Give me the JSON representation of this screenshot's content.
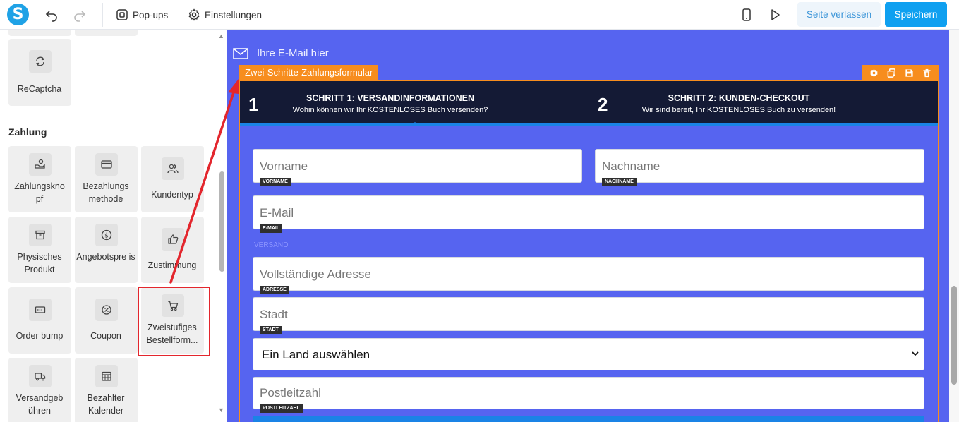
{
  "topbar": {
    "logo_letter": "S",
    "popups_label": "Pop-ups",
    "settings_label": "Einstellungen",
    "leave_label": "Seite verlassen",
    "save_label": "Speichern"
  },
  "sidebar": {
    "top_tile": {
      "label": "ReCaptcha",
      "icon": "refresh-icon"
    },
    "section_title": "Zahlung",
    "tiles": [
      {
        "label": "Zahlungskno pf",
        "icon": "hand-coin-icon"
      },
      {
        "label": "Bezahlungs methode",
        "icon": "credit-card-icon"
      },
      {
        "label": "Kundentyp",
        "icon": "users-icon"
      },
      {
        "label": "Physisches Produkt",
        "icon": "box-icon"
      },
      {
        "label": "Angebotspre is",
        "icon": "dollar-circle-icon"
      },
      {
        "label": "Zustimmung",
        "icon": "thumbs-up-icon"
      },
      {
        "label": "Order bump",
        "icon": "order-bump-icon"
      },
      {
        "label": "Coupon",
        "icon": "percent-icon"
      },
      {
        "label": "Zweistufiges Bestellform...",
        "icon": "cart-icon"
      },
      {
        "label": "Versandgeb ühren",
        "icon": "truck-icon"
      },
      {
        "label": "Bezahlter Kalender",
        "icon": "calendar-icon"
      }
    ]
  },
  "canvas": {
    "email_text": "Ihre E-Mail hier",
    "element_label": "Zwei-Schritte-Zahlungsformular",
    "steps": [
      {
        "number": "1",
        "title": "SCHRITT 1: VERSANDINFORMATIONEN",
        "subtitle": "Wohin können wir Ihr KOSTENLOSES Buch versenden?"
      },
      {
        "number": "2",
        "title": "SCHRITT 2: KUNDEN-CHECKOUT",
        "subtitle": "Wir sind bereit, Ihr KOSTENLOSES Buch zu versenden!"
      }
    ],
    "fields": {
      "firstname": {
        "placeholder": "Vorname",
        "tag": "VORNAME"
      },
      "lastname": {
        "placeholder": "Nachname",
        "tag": "NACHNAME"
      },
      "email": {
        "placeholder": "E-Mail",
        "tag": "E-MAIL"
      },
      "shipping_section": "VERSAND",
      "address": {
        "placeholder": "Vollständige Adresse",
        "tag": "ADRESSE"
      },
      "city": {
        "placeholder": "Stadt",
        "tag": "STADT"
      },
      "country_select": "Ein Land auswählen",
      "zip": {
        "placeholder": "Postleitzahl",
        "tag": "POSTLEITZAHL"
      }
    }
  },
  "colors": {
    "canvas_bg": "#5664f0",
    "orange": "#f78d1e",
    "step_bar": "#141a35",
    "accent_blue": "#1a83e6",
    "save_btn": "#0fa0f0",
    "annotation_red": "#e3262d"
  }
}
